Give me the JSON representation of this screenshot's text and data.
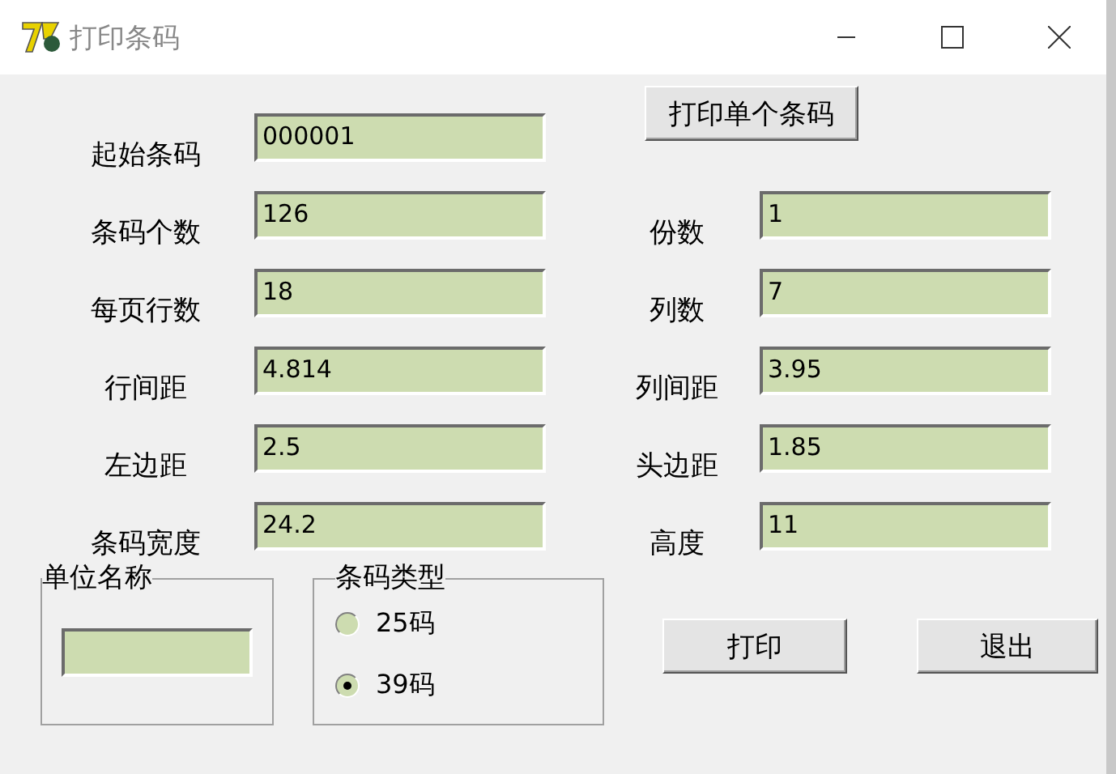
{
  "window": {
    "title": "打印条码"
  },
  "rows": [
    {
      "left": {
        "label": "起始条码",
        "value": "000001"
      },
      "right": {
        "kind": "button",
        "label": "打印单个条码"
      }
    },
    {
      "left": {
        "label": "条码个数",
        "value": "126"
      },
      "right": {
        "kind": "field",
        "label": "份数",
        "value": "1"
      }
    },
    {
      "left": {
        "label": "每页行数",
        "value": "18"
      },
      "right": {
        "kind": "field",
        "label": "列数",
        "value": "7"
      }
    },
    {
      "left": {
        "label": "行间距",
        "value": "4.814"
      },
      "right": {
        "kind": "field",
        "label": "列间距",
        "value": "3.95"
      }
    },
    {
      "left": {
        "label": "左边距",
        "value": "2.5"
      },
      "right": {
        "kind": "field",
        "label": "头边距",
        "value": "1.85"
      }
    },
    {
      "left": {
        "label": "条码宽度",
        "value": "24.2"
      },
      "right": {
        "kind": "field",
        "label": "高度",
        "value": "11"
      }
    }
  ],
  "unit_group": {
    "title": "单位名称"
  },
  "type_group": {
    "title": "条码类型",
    "options": [
      {
        "label": "25码",
        "selected": false
      },
      {
        "label": "39码",
        "selected": true
      }
    ]
  },
  "buttons": [
    "打印",
    "退出"
  ]
}
